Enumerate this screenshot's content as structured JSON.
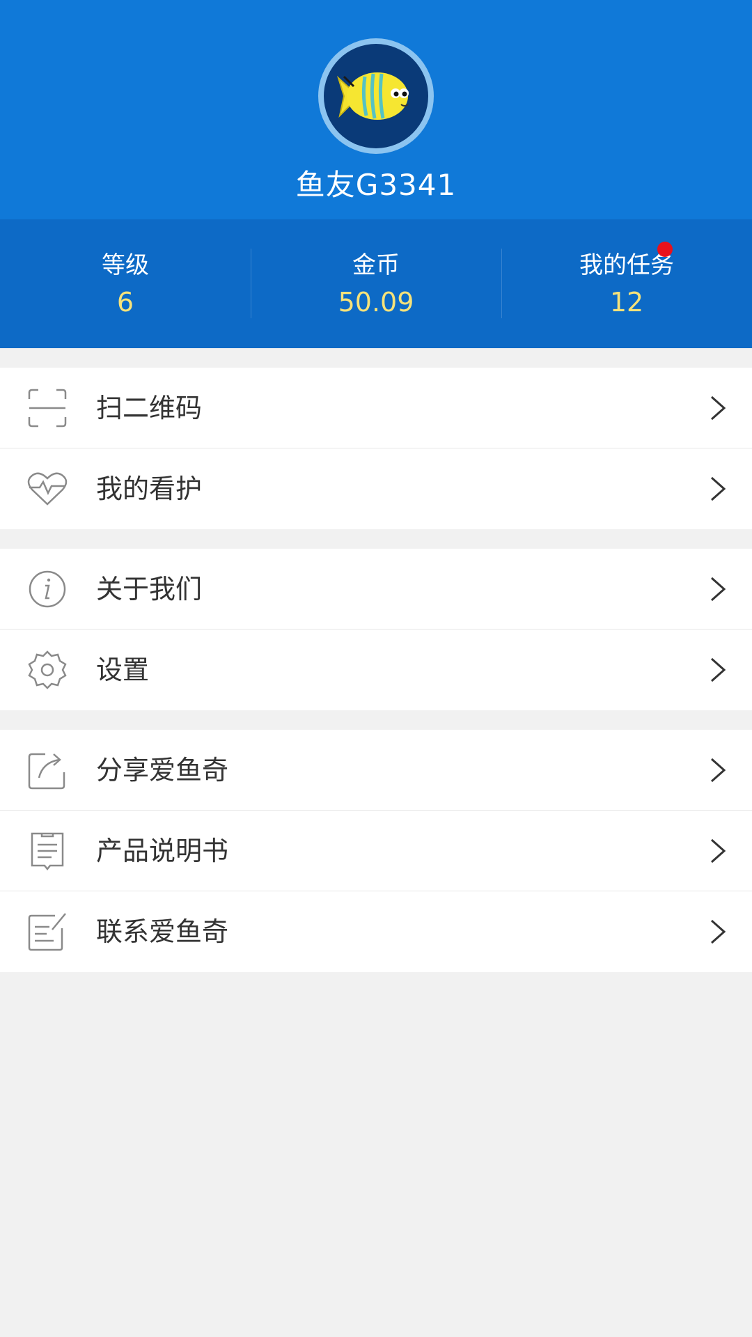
{
  "profile": {
    "nickname": "鱼友G3341",
    "avatar_icon": "fish-avatar-icon"
  },
  "stats": [
    {
      "label": "等级",
      "value": "6"
    },
    {
      "label": "金币",
      "value": "50.09"
    },
    {
      "label": "我的任务",
      "value": "12",
      "has_badge": true
    }
  ],
  "menu_groups": [
    {
      "items": [
        {
          "label": "扫二维码",
          "icon": "scan-qr-icon"
        },
        {
          "label": "我的看护",
          "icon": "heart-pulse-icon"
        }
      ]
    },
    {
      "items": [
        {
          "label": "关于我们",
          "icon": "info-icon"
        },
        {
          "label": "设置",
          "icon": "gear-icon"
        }
      ]
    },
    {
      "items": [
        {
          "label": "分享爱鱼奇",
          "icon": "share-icon"
        },
        {
          "label": "产品说明书",
          "icon": "manual-icon"
        },
        {
          "label": "联系爱鱼奇",
          "icon": "contact-edit-icon"
        }
      ]
    }
  ],
  "colors": {
    "header": "#1079d8",
    "stats_bar": "#0d6ac6",
    "stat_value": "#f6e27a",
    "badge": "#e8121c",
    "background": "#f1f1f1"
  }
}
